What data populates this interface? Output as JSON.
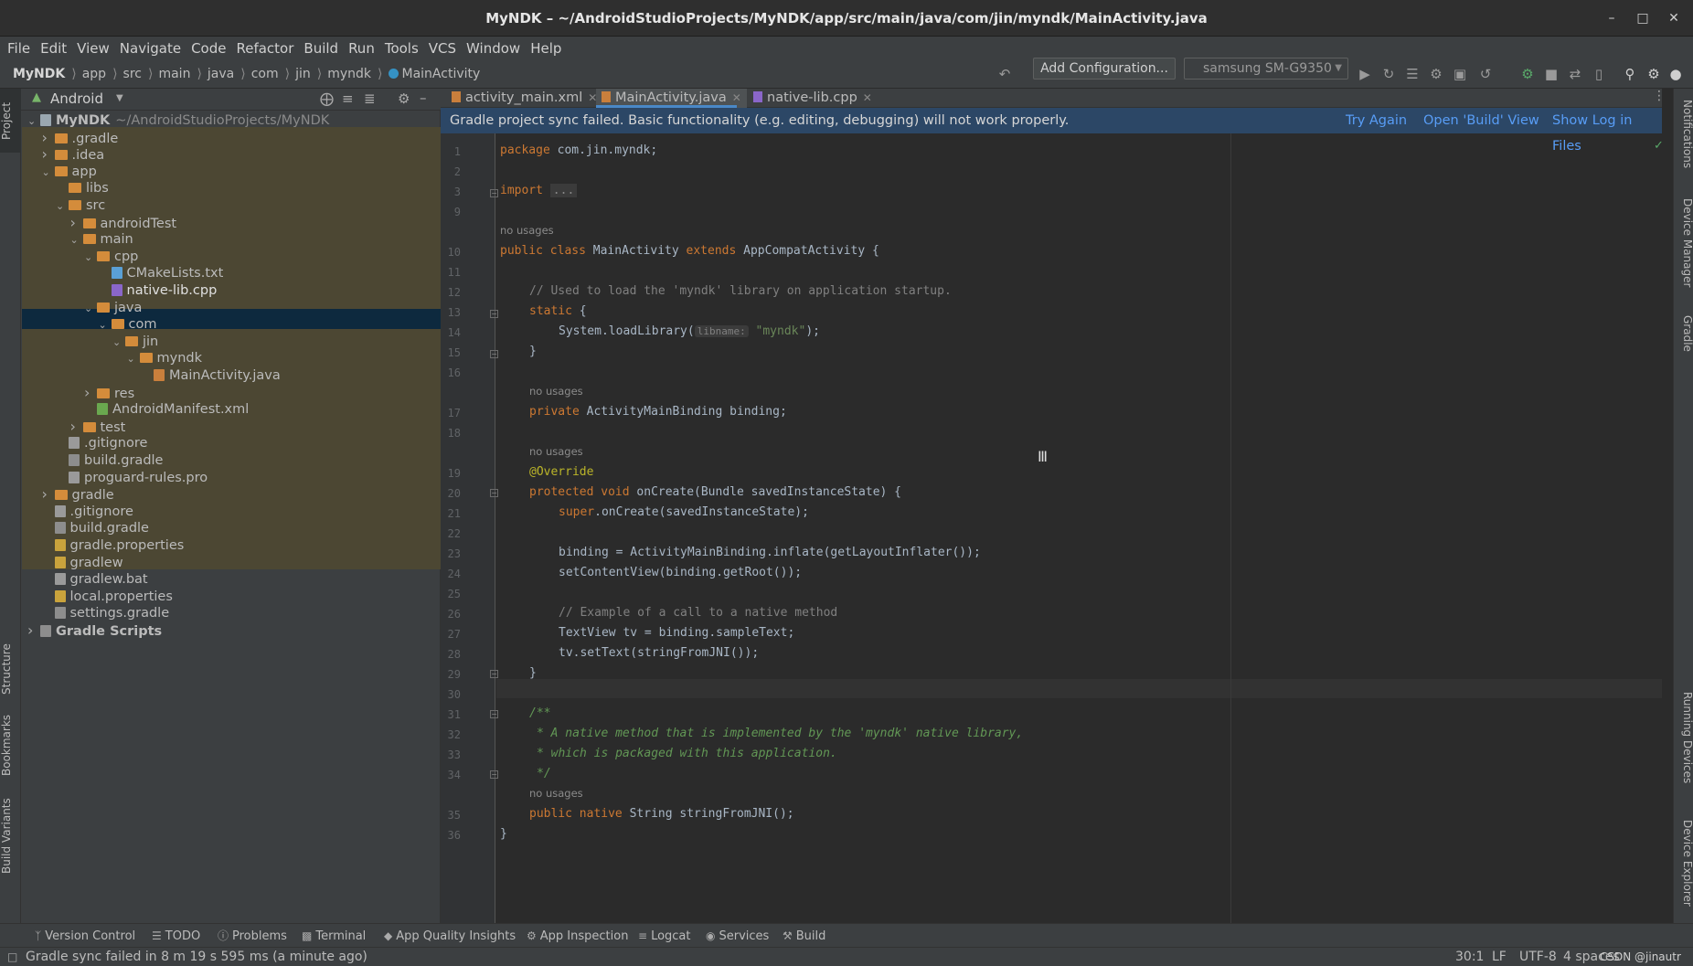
{
  "window": {
    "title": "MyNDK – ~/AndroidStudioProjects/MyNDK/app/src/main/java/com/jin/myndk/MainActivity.java"
  },
  "menu": [
    "File",
    "Edit",
    "View",
    "Navigate",
    "Code",
    "Refactor",
    "Build",
    "Run",
    "Tools",
    "VCS",
    "Window",
    "Help"
  ],
  "breadcrumb": [
    "MyNDK",
    "app",
    "src",
    "main",
    "java",
    "com",
    "jin",
    "myndk",
    "MainActivity"
  ],
  "toolbar": {
    "add_configuration": "Add Configuration...",
    "device": "samsung SM-G9350"
  },
  "left_tabs": {
    "project": "Project",
    "structure": "Structure",
    "bookmarks": "Bookmarks",
    "build_variants": "Build Variants"
  },
  "right_tabs": {
    "notifications": "Notifications",
    "device_manager": "Device Manager",
    "gradle": "Gradle",
    "running_devices": "Running Devices",
    "device_explorer": "Device Explorer"
  },
  "project_panel": {
    "view_selector": "Android",
    "tree": [
      {
        "label": "MyNDK",
        "suffix": "~/AndroidStudioProjects/MyNDK",
        "indent": 0,
        "arrow": "down",
        "icon": "module"
      },
      {
        "label": ".gradle",
        "indent": 1,
        "arrow": "right",
        "icon": "folder"
      },
      {
        "label": ".idea",
        "indent": 1,
        "arrow": "right",
        "icon": "folder"
      },
      {
        "label": "app",
        "indent": 1,
        "arrow": "down",
        "icon": "folder"
      },
      {
        "label": "libs",
        "indent": 2,
        "arrow": "",
        "icon": "folder"
      },
      {
        "label": "src",
        "indent": 2,
        "arrow": "down",
        "icon": "folder"
      },
      {
        "label": "androidTest",
        "indent": 3,
        "arrow": "right",
        "icon": "folder"
      },
      {
        "label": "main",
        "indent": 3,
        "arrow": "down",
        "icon": "folder"
      },
      {
        "label": "cpp",
        "indent": 4,
        "arrow": "down",
        "icon": "folder"
      },
      {
        "label": "CMakeLists.txt",
        "indent": 5,
        "arrow": "",
        "icon": "cmake"
      },
      {
        "label": "native-lib.cpp",
        "indent": 5,
        "arrow": "",
        "icon": "cpp",
        "selected": true
      },
      {
        "label": "java",
        "indent": 4,
        "arrow": "down",
        "icon": "folder"
      },
      {
        "label": "com",
        "indent": 5,
        "arrow": "down",
        "icon": "folder"
      },
      {
        "label": "jin",
        "indent": 6,
        "arrow": "down",
        "icon": "folder"
      },
      {
        "label": "myndk",
        "indent": 7,
        "arrow": "down",
        "icon": "folder"
      },
      {
        "label": "MainActivity.java",
        "indent": 8,
        "arrow": "",
        "icon": "java"
      },
      {
        "label": "res",
        "indent": 4,
        "arrow": "right",
        "icon": "folder"
      },
      {
        "label": "AndroidManifest.xml",
        "indent": 4,
        "arrow": "",
        "icon": "xml"
      },
      {
        "label": "test",
        "indent": 3,
        "arrow": "right",
        "icon": "folder"
      },
      {
        "label": ".gitignore",
        "indent": 2,
        "arrow": "",
        "icon": "text"
      },
      {
        "label": "build.gradle",
        "indent": 2,
        "arrow": "",
        "icon": "gradle"
      },
      {
        "label": "proguard-rules.pro",
        "indent": 2,
        "arrow": "",
        "icon": "text"
      },
      {
        "label": "gradle",
        "indent": 1,
        "arrow": "right",
        "icon": "folder"
      },
      {
        "label": ".gitignore",
        "indent": 1,
        "arrow": "",
        "icon": "text"
      },
      {
        "label": "build.gradle",
        "indent": 1,
        "arrow": "",
        "icon": "gradle"
      },
      {
        "label": "gradle.properties",
        "indent": 1,
        "arrow": "",
        "icon": "props"
      },
      {
        "label": "gradlew",
        "indent": 1,
        "arrow": "",
        "icon": "props"
      },
      {
        "label": "gradlew.bat",
        "indent": 1,
        "arrow": "",
        "icon": "text"
      },
      {
        "label": "local.properties",
        "indent": 1,
        "arrow": "",
        "icon": "props"
      },
      {
        "label": "settings.gradle",
        "indent": 1,
        "arrow": "",
        "icon": "gradle"
      },
      {
        "label": "Gradle Scripts",
        "indent": 0,
        "arrow": "right",
        "icon": "gradle"
      }
    ]
  },
  "tabs": [
    {
      "label": "activity_main.xml",
      "active": false
    },
    {
      "label": "MainActivity.java",
      "active": true
    },
    {
      "label": "native-lib.cpp",
      "active": false
    }
  ],
  "banner": {
    "message": "Gradle project sync failed. Basic functionality (e.g. editing, debugging) will not work properly.",
    "try_again": "Try Again",
    "open_build": "Open 'Build' View",
    "show_log": "Show Log in Files"
  },
  "editor": {
    "usage_hint": "no usages",
    "param_hint": "libname:",
    "lines": [
      {
        "n": "1",
        "text": "package com.jin.myndk;"
      },
      {
        "n": "2",
        "text": ""
      },
      {
        "n": "3",
        "text": "import ..."
      },
      {
        "n": "9",
        "text": ""
      },
      {
        "n": "10",
        "text": "public class MainActivity extends AppCompatActivity {"
      },
      {
        "n": "11",
        "text": ""
      },
      {
        "n": "12",
        "text": "// Used to load the 'myndk' library on application startup."
      },
      {
        "n": "13",
        "text": "static {"
      },
      {
        "n": "14",
        "text": "System.loadLibrary(\"myndk\");"
      },
      {
        "n": "15",
        "text": "}"
      },
      {
        "n": "16",
        "text": ""
      },
      {
        "n": "17",
        "text": "private ActivityMainBinding binding;"
      },
      {
        "n": "18",
        "text": ""
      },
      {
        "n": "19",
        "text": "@Override"
      },
      {
        "n": "20",
        "text": "protected void onCreate(Bundle savedInstanceState) {"
      },
      {
        "n": "21",
        "text": "super.onCreate(savedInstanceState);"
      },
      {
        "n": "22",
        "text": ""
      },
      {
        "n": "23",
        "text": "binding = ActivityMainBinding.inflate(getLayoutInflater());"
      },
      {
        "n": "24",
        "text": "setContentView(binding.getRoot());"
      },
      {
        "n": "25",
        "text": ""
      },
      {
        "n": "26",
        "text": "// Example of a call to a native method"
      },
      {
        "n": "27",
        "text": "TextView tv = binding.sampleText;"
      },
      {
        "n": "28",
        "text": "tv.setText(stringFromJNI());"
      },
      {
        "n": "29",
        "text": "}"
      },
      {
        "n": "30",
        "text": ""
      },
      {
        "n": "31",
        "text": "/**"
      },
      {
        "n": "32",
        "text": "* A native method that is implemented by the 'myndk' native library,"
      },
      {
        "n": "33",
        "text": "* which is packaged with this application."
      },
      {
        "n": "34",
        "text": "*/"
      },
      {
        "n": "35",
        "text": "public native String stringFromJNI();"
      },
      {
        "n": "36",
        "text": "}"
      }
    ]
  },
  "bottom_tools": [
    "Version Control",
    "TODO",
    "Problems",
    "Terminal",
    "App Quality Insights",
    "App Inspection",
    "Logcat",
    "Services",
    "Build"
  ],
  "status": {
    "message": "Gradle sync failed in 8 m 19 s 595 ms (a minute ago)",
    "position": "30:1",
    "line_sep": "LF",
    "encoding": "UTF-8",
    "indent": "4 spaces",
    "watermark": "CSDN @jinautr"
  },
  "colors": {
    "accent": "#4a88c7",
    "banner_bg": "#2c4766",
    "link": "#589df6",
    "folder": "#d48c3b"
  }
}
